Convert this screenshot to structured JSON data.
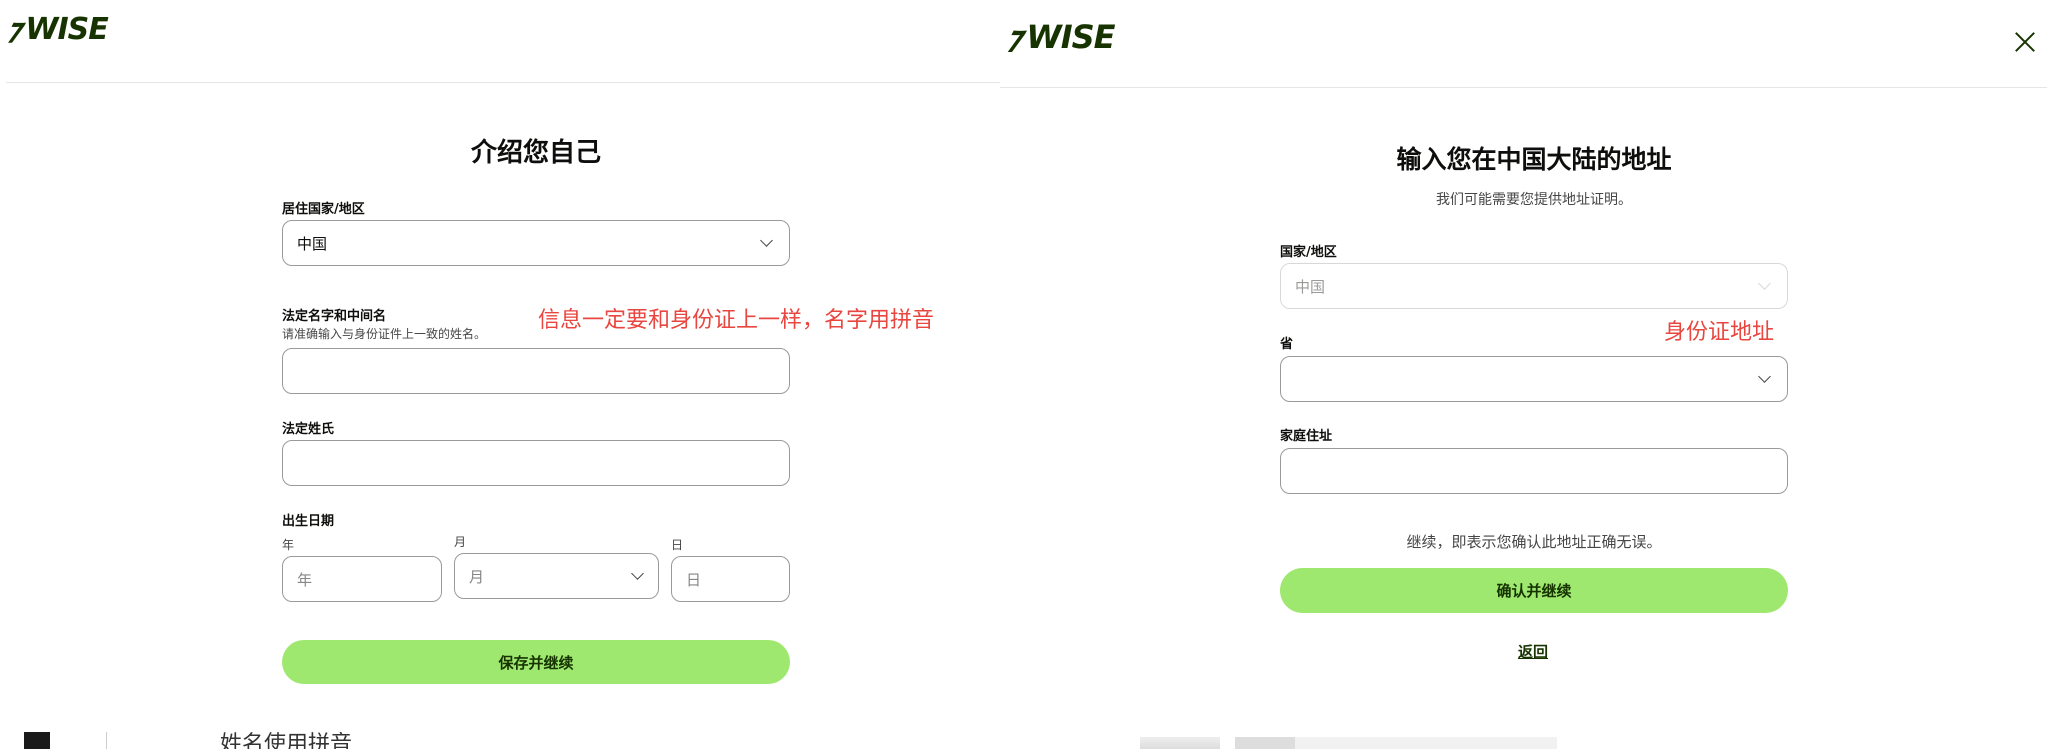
{
  "left": {
    "logo": "WISE",
    "title": "介绍您自己",
    "country": {
      "label": "居住国家/地区",
      "value": "中国"
    },
    "first_name": {
      "label": "法定名字和中间名",
      "hint": "请准确输入与身份证件上一致的姓名。",
      "value": ""
    },
    "last_name": {
      "label": "法定姓氏",
      "value": ""
    },
    "dob": {
      "label": "出生日期",
      "year": {
        "label": "年",
        "placeholder": "年"
      },
      "month": {
        "label": "月",
        "placeholder": "月"
      },
      "day": {
        "label": "日",
        "placeholder": "日"
      }
    },
    "save_button": "保存并继续",
    "annotation": "信息一定要和身份证上一样，名字用拼音",
    "cut_text": "姓名使用拼音"
  },
  "right": {
    "logo": "WISE",
    "title": "输入您在中国大陆的地址",
    "subtitle": "我们可能需要您提供地址证明。",
    "country": {
      "label": "国家/地区",
      "value": "中国"
    },
    "province": {
      "label": "省",
      "value": ""
    },
    "home_address": {
      "label": "家庭住址",
      "value": ""
    },
    "confirm_note": "继续，即表示您确认此地址正确无误。",
    "confirm_button": "确认并继续",
    "back_link": "返回",
    "annotation": "身份证地址"
  },
  "colors": {
    "brand": "#163300",
    "accent": "#9fe870",
    "annotation": "#e8463f"
  },
  "icons": [
    "wise-flag-icon",
    "chevron-down-icon",
    "close-icon"
  ]
}
